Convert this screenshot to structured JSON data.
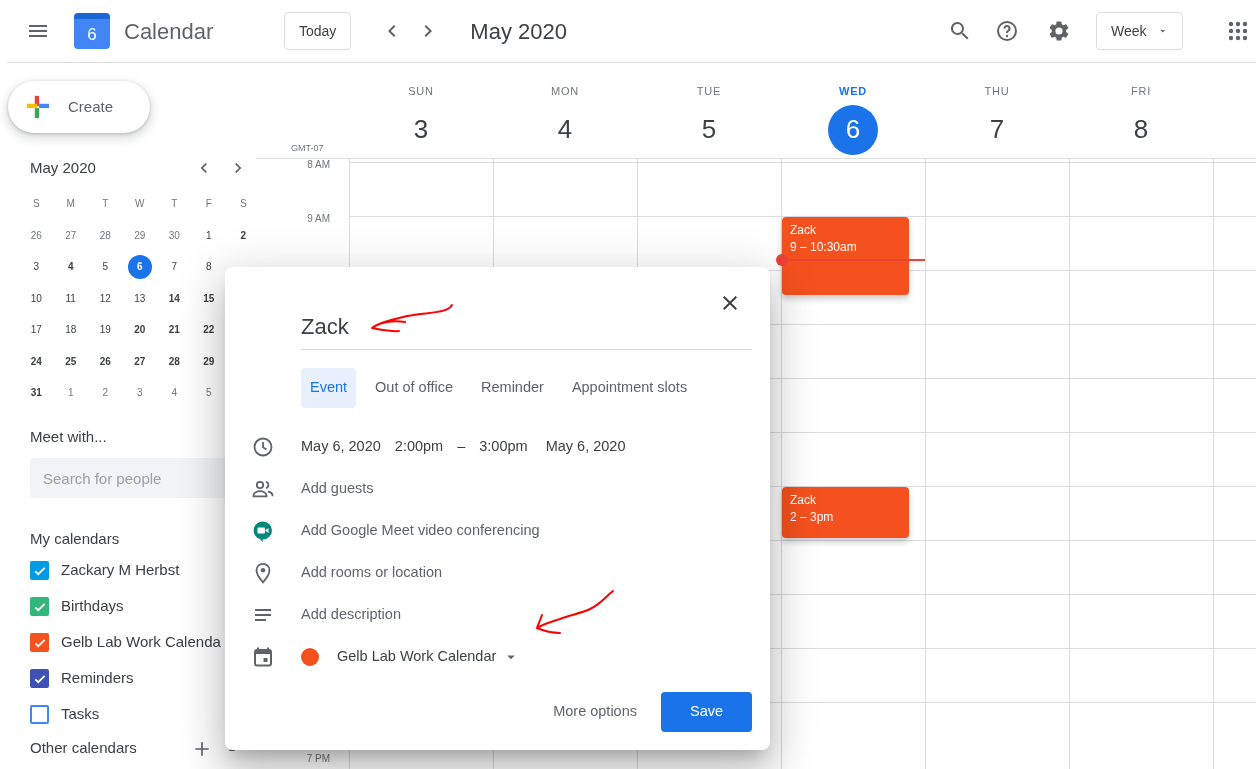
{
  "top_bar": {
    "logo_day": "6",
    "app_name": "Calendar",
    "today_button": "Today",
    "period": "May 2020",
    "view_select": "Week"
  },
  "sidebar": {
    "create_button": "Create",
    "mini_calendar": {
      "title": "May 2020",
      "weekdays": [
        "S",
        "M",
        "T",
        "W",
        "T",
        "F",
        "S"
      ],
      "weeks": [
        [
          {
            "day": "26",
            "muted": true,
            "bold": false,
            "selected": false
          },
          {
            "day": "27",
            "muted": true,
            "bold": false,
            "selected": false
          },
          {
            "day": "28",
            "muted": true,
            "bold": false,
            "selected": false
          },
          {
            "day": "29",
            "muted": true,
            "bold": false,
            "selected": false
          },
          {
            "day": "30",
            "muted": true,
            "bold": false,
            "selected": false
          },
          {
            "day": "1",
            "muted": false,
            "bold": false,
            "selected": false
          },
          {
            "day": "2",
            "muted": false,
            "bold": true,
            "selected": false
          }
        ],
        [
          {
            "day": "3",
            "muted": false,
            "bold": false,
            "selected": false
          },
          {
            "day": "4",
            "muted": false,
            "bold": true,
            "selected": false
          },
          {
            "day": "5",
            "muted": false,
            "bold": false,
            "selected": false
          },
          {
            "day": "6",
            "muted": false,
            "bold": false,
            "selected": true
          },
          {
            "day": "7",
            "muted": false,
            "bold": false,
            "selected": false
          },
          {
            "day": "8",
            "muted": false,
            "bold": false,
            "selected": false
          }
        ],
        [
          {
            "day": "10",
            "muted": false,
            "bold": false,
            "selected": false
          },
          {
            "day": "11",
            "muted": false,
            "bold": false,
            "selected": false
          },
          {
            "day": "12",
            "muted": false,
            "bold": false,
            "selected": false
          },
          {
            "day": "13",
            "muted": false,
            "bold": false,
            "selected": false
          },
          {
            "day": "14",
            "muted": false,
            "bold": true,
            "selected": false
          },
          {
            "day": "15",
            "muted": false,
            "bold": true,
            "selected": false
          }
        ],
        [
          {
            "day": "17",
            "muted": false,
            "bold": false,
            "selected": false
          },
          {
            "day": "18",
            "muted": false,
            "bold": false,
            "selected": false
          },
          {
            "day": "19",
            "muted": false,
            "bold": false,
            "selected": false
          },
          {
            "day": "20",
            "muted": false,
            "bold": true,
            "selected": false
          },
          {
            "day": "21",
            "muted": false,
            "bold": true,
            "selected": false
          },
          {
            "day": "22",
            "muted": false,
            "bold": true,
            "selected": false
          }
        ],
        [
          {
            "day": "24",
            "muted": false,
            "bold": true,
            "selected": false
          },
          {
            "day": "25",
            "muted": false,
            "bold": true,
            "selected": false
          },
          {
            "day": "26",
            "muted": false,
            "bold": true,
            "selected": false
          },
          {
            "day": "27",
            "muted": false,
            "bold": true,
            "selected": false
          },
          {
            "day": "28",
            "muted": false,
            "bold": true,
            "selected": false
          },
          {
            "day": "29",
            "muted": false,
            "bold": true,
            "selected": false
          }
        ],
        [
          {
            "day": "31",
            "muted": false,
            "bold": true,
            "selected": false
          },
          {
            "day": "1",
            "muted": true,
            "bold": false,
            "selected": false
          },
          {
            "day": "2",
            "muted": true,
            "bold": false,
            "selected": false
          },
          {
            "day": "3",
            "muted": true,
            "bold": false,
            "selected": false
          },
          {
            "day": "4",
            "muted": true,
            "bold": false,
            "selected": false
          },
          {
            "day": "5",
            "muted": true,
            "bold": false,
            "selected": false
          }
        ]
      ]
    },
    "meet_with": {
      "heading": "Meet with...",
      "placeholder": "Search for people"
    },
    "my_calendars": {
      "heading": "My calendars",
      "items": [
        {
          "label": "Zackary M Herbst",
          "color": "#039be5",
          "checked": true
        },
        {
          "label": "Birthdays",
          "color": "#33b679",
          "checked": true
        },
        {
          "label": "Gelb Lab Work Calenda",
          "color": "#f4511e",
          "checked": true
        },
        {
          "label": "Reminders",
          "color": "#3f51b5",
          "checked": true
        },
        {
          "label": "Tasks",
          "color": "#4285f4",
          "checked": false
        }
      ]
    },
    "other_calendars": {
      "heading": "Other calendars"
    }
  },
  "week": {
    "timezone": "GMT-07",
    "hour_labels": [
      "8 AM",
      "9 AM",
      "7 PM"
    ],
    "days": [
      {
        "name": "SUN",
        "number": "3",
        "today": false
      },
      {
        "name": "MON",
        "number": "4",
        "today": false
      },
      {
        "name": "TUE",
        "number": "5",
        "today": false
      },
      {
        "name": "WED",
        "number": "6",
        "today": true,
        "events": [
          {
            "title": "Zack",
            "time": "9 – 10:30am"
          },
          {
            "title": "Zack",
            "time": "2 – 3pm"
          }
        ]
      },
      {
        "name": "THU",
        "number": "7",
        "today": false
      },
      {
        "name": "FRI",
        "number": "8",
        "today": false
      }
    ]
  },
  "event_dialog": {
    "title": "Zack",
    "tabs": [
      {
        "label": "Event",
        "selected": true
      },
      {
        "label": "Out of office",
        "selected": false
      },
      {
        "label": "Reminder",
        "selected": false
      },
      {
        "label": "Appointment slots",
        "selected": false
      }
    ],
    "date_time": {
      "start_date": "May 6, 2020",
      "start_time": "2:00pm",
      "separator": "–",
      "end_time": "3:00pm",
      "end_date": "May 6, 2020"
    },
    "rows": [
      {
        "kind": "guests",
        "label": "Add guests"
      },
      {
        "kind": "meet",
        "label": "Add Google Meet video conferencing"
      },
      {
        "kind": "location",
        "label": "Add rooms or location"
      },
      {
        "kind": "description",
        "label": "Add description"
      }
    ],
    "calendar": "Gelb Lab Work Calendar",
    "more_options": "More options",
    "save": "Save"
  }
}
